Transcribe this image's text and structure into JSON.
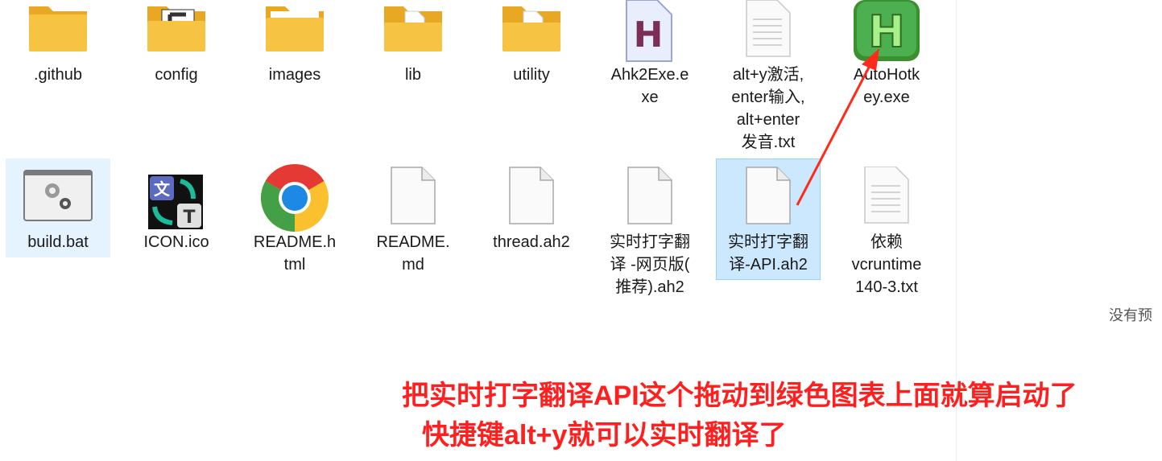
{
  "files": [
    {
      "name": ".github",
      "icon": "folder-icon"
    },
    {
      "name": "config",
      "icon": "folder-icon"
    },
    {
      "name": "images",
      "icon": "folder-icon"
    },
    {
      "name": "lib",
      "icon": "folder-icon"
    },
    {
      "name": "utility",
      "icon": "folder-icon"
    },
    {
      "name": "Ahk2Exe.e\nxe",
      "icon": "ahk2exe-icon"
    },
    {
      "name": "alt+y激活,\nenter输入,\nalt+enter\n发音.txt",
      "icon": "text-file-icon"
    },
    {
      "name": "AutoHotk\ney.exe",
      "icon": "autohotkey-icon"
    },
    {
      "name": "build.bat",
      "icon": "batch-file-icon"
    },
    {
      "name": "ICON.ico",
      "icon": "translate-ico-icon"
    },
    {
      "name": "README.h\ntml",
      "icon": "chrome-icon"
    },
    {
      "name": "README.\nmd",
      "icon": "blank-file-icon"
    },
    {
      "name": "thread.ah2",
      "icon": "blank-file-icon"
    },
    {
      "name": "实时打字翻\n译 -网页版(\n推荐).ah2",
      "icon": "blank-file-icon"
    },
    {
      "name": "实时打字翻\n译-API.ah2",
      "icon": "blank-file-icon"
    },
    {
      "name": "依赖\nvcruntime\n140-3.txt",
      "icon": "text-file-icon"
    }
  ],
  "preview_pane": {
    "text": "没有预"
  },
  "annotation": {
    "line1": "把实时打字翻译API这个拖动到绿色图表上面就算启动了",
    "line2": "快捷键alt+y就可以实时翻译了",
    "color": "#ff1f1f"
  },
  "colors": {
    "selection": "#cce8ff",
    "folder": "#f6c343",
    "ahk_green": "#4caf50"
  }
}
